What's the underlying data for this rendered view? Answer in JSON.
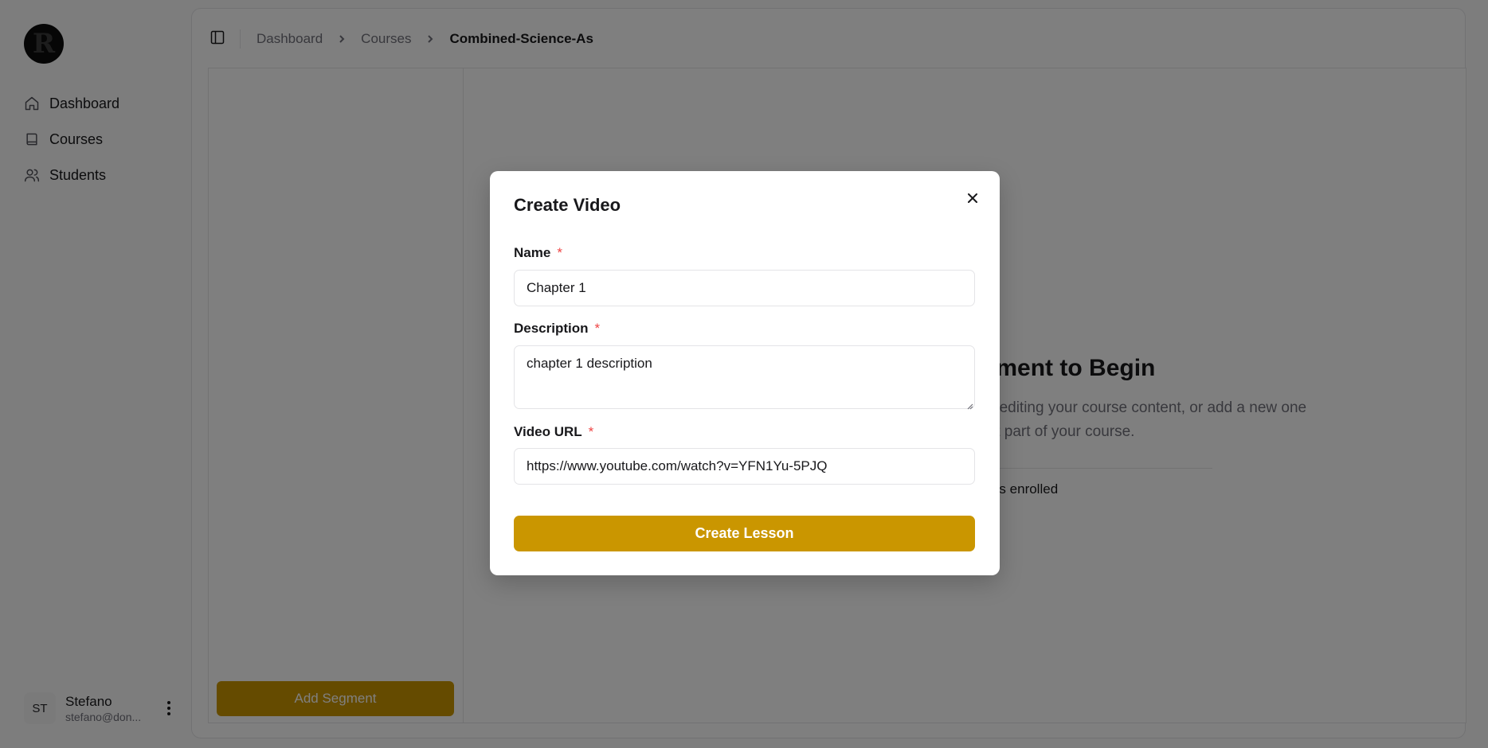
{
  "sidebar": {
    "logo_letter": "R",
    "nav": [
      {
        "label": "Dashboard",
        "icon": "home-icon"
      },
      {
        "label": "Courses",
        "icon": "book-icon"
      },
      {
        "label": "Students",
        "icon": "users-icon"
      }
    ],
    "user": {
      "initials": "ST",
      "name": "Stefano",
      "email": "stefano@don..."
    }
  },
  "header": {
    "breadcrumbs": [
      "Dashboard",
      "Courses",
      "Combined-Science-As"
    ]
  },
  "content": {
    "add_segment_label": "Add Segment",
    "empty_title": "Select a Segment to Begin",
    "empty_text": "Choose a segment from the sidebar to start editing your course content, or add a new one to focus a different part of your course.",
    "enrolled_label": "Students enrolled"
  },
  "modal": {
    "title": "Create Video",
    "name_label": "Name",
    "name_value": "Chapter 1",
    "description_label": "Description",
    "description_value": "chapter 1 description",
    "url_label": "Video URL",
    "url_value": "https://www.youtube.com/watch?v=YFN1Yu-5PJQ",
    "required_mark": "*",
    "submit_label": "Create Lesson"
  },
  "colors": {
    "accent": "#ca9600",
    "required": "#ef4444",
    "overlay": "rgba(0,0,0,0.5)"
  }
}
